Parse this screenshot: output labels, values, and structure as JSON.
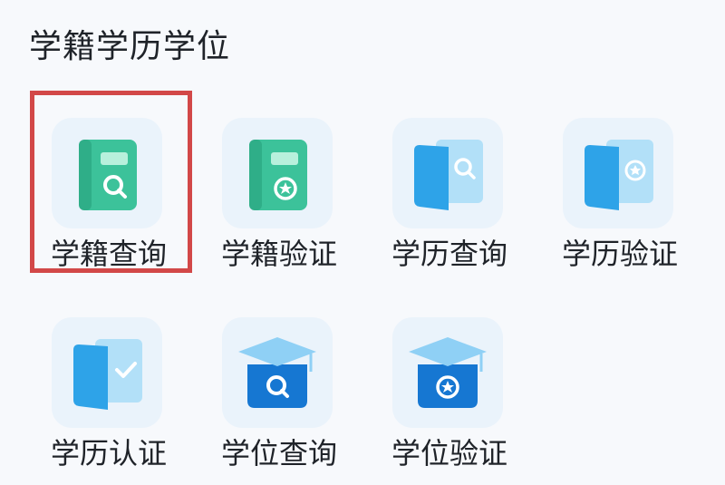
{
  "section": {
    "title": "学籍学历学位"
  },
  "items": [
    {
      "label": "学籍查询",
      "icon": "green-book-search-icon"
    },
    {
      "label": "学籍验证",
      "icon": "green-book-verify-icon"
    },
    {
      "label": "学历查询",
      "icon": "blue-book-search-icon"
    },
    {
      "label": "学历验证",
      "icon": "blue-book-verify-icon"
    },
    {
      "label": "学历认证",
      "icon": "blue-book-check-icon"
    },
    {
      "label": "学位查询",
      "icon": "graduation-cap-search-icon"
    },
    {
      "label": "学位验证",
      "icon": "graduation-cap-verify-icon"
    }
  ],
  "colors": {
    "highlight": "#d24848",
    "green": "#3cc29a",
    "blue": "#2ea3e8",
    "navy": "#1677d2"
  }
}
